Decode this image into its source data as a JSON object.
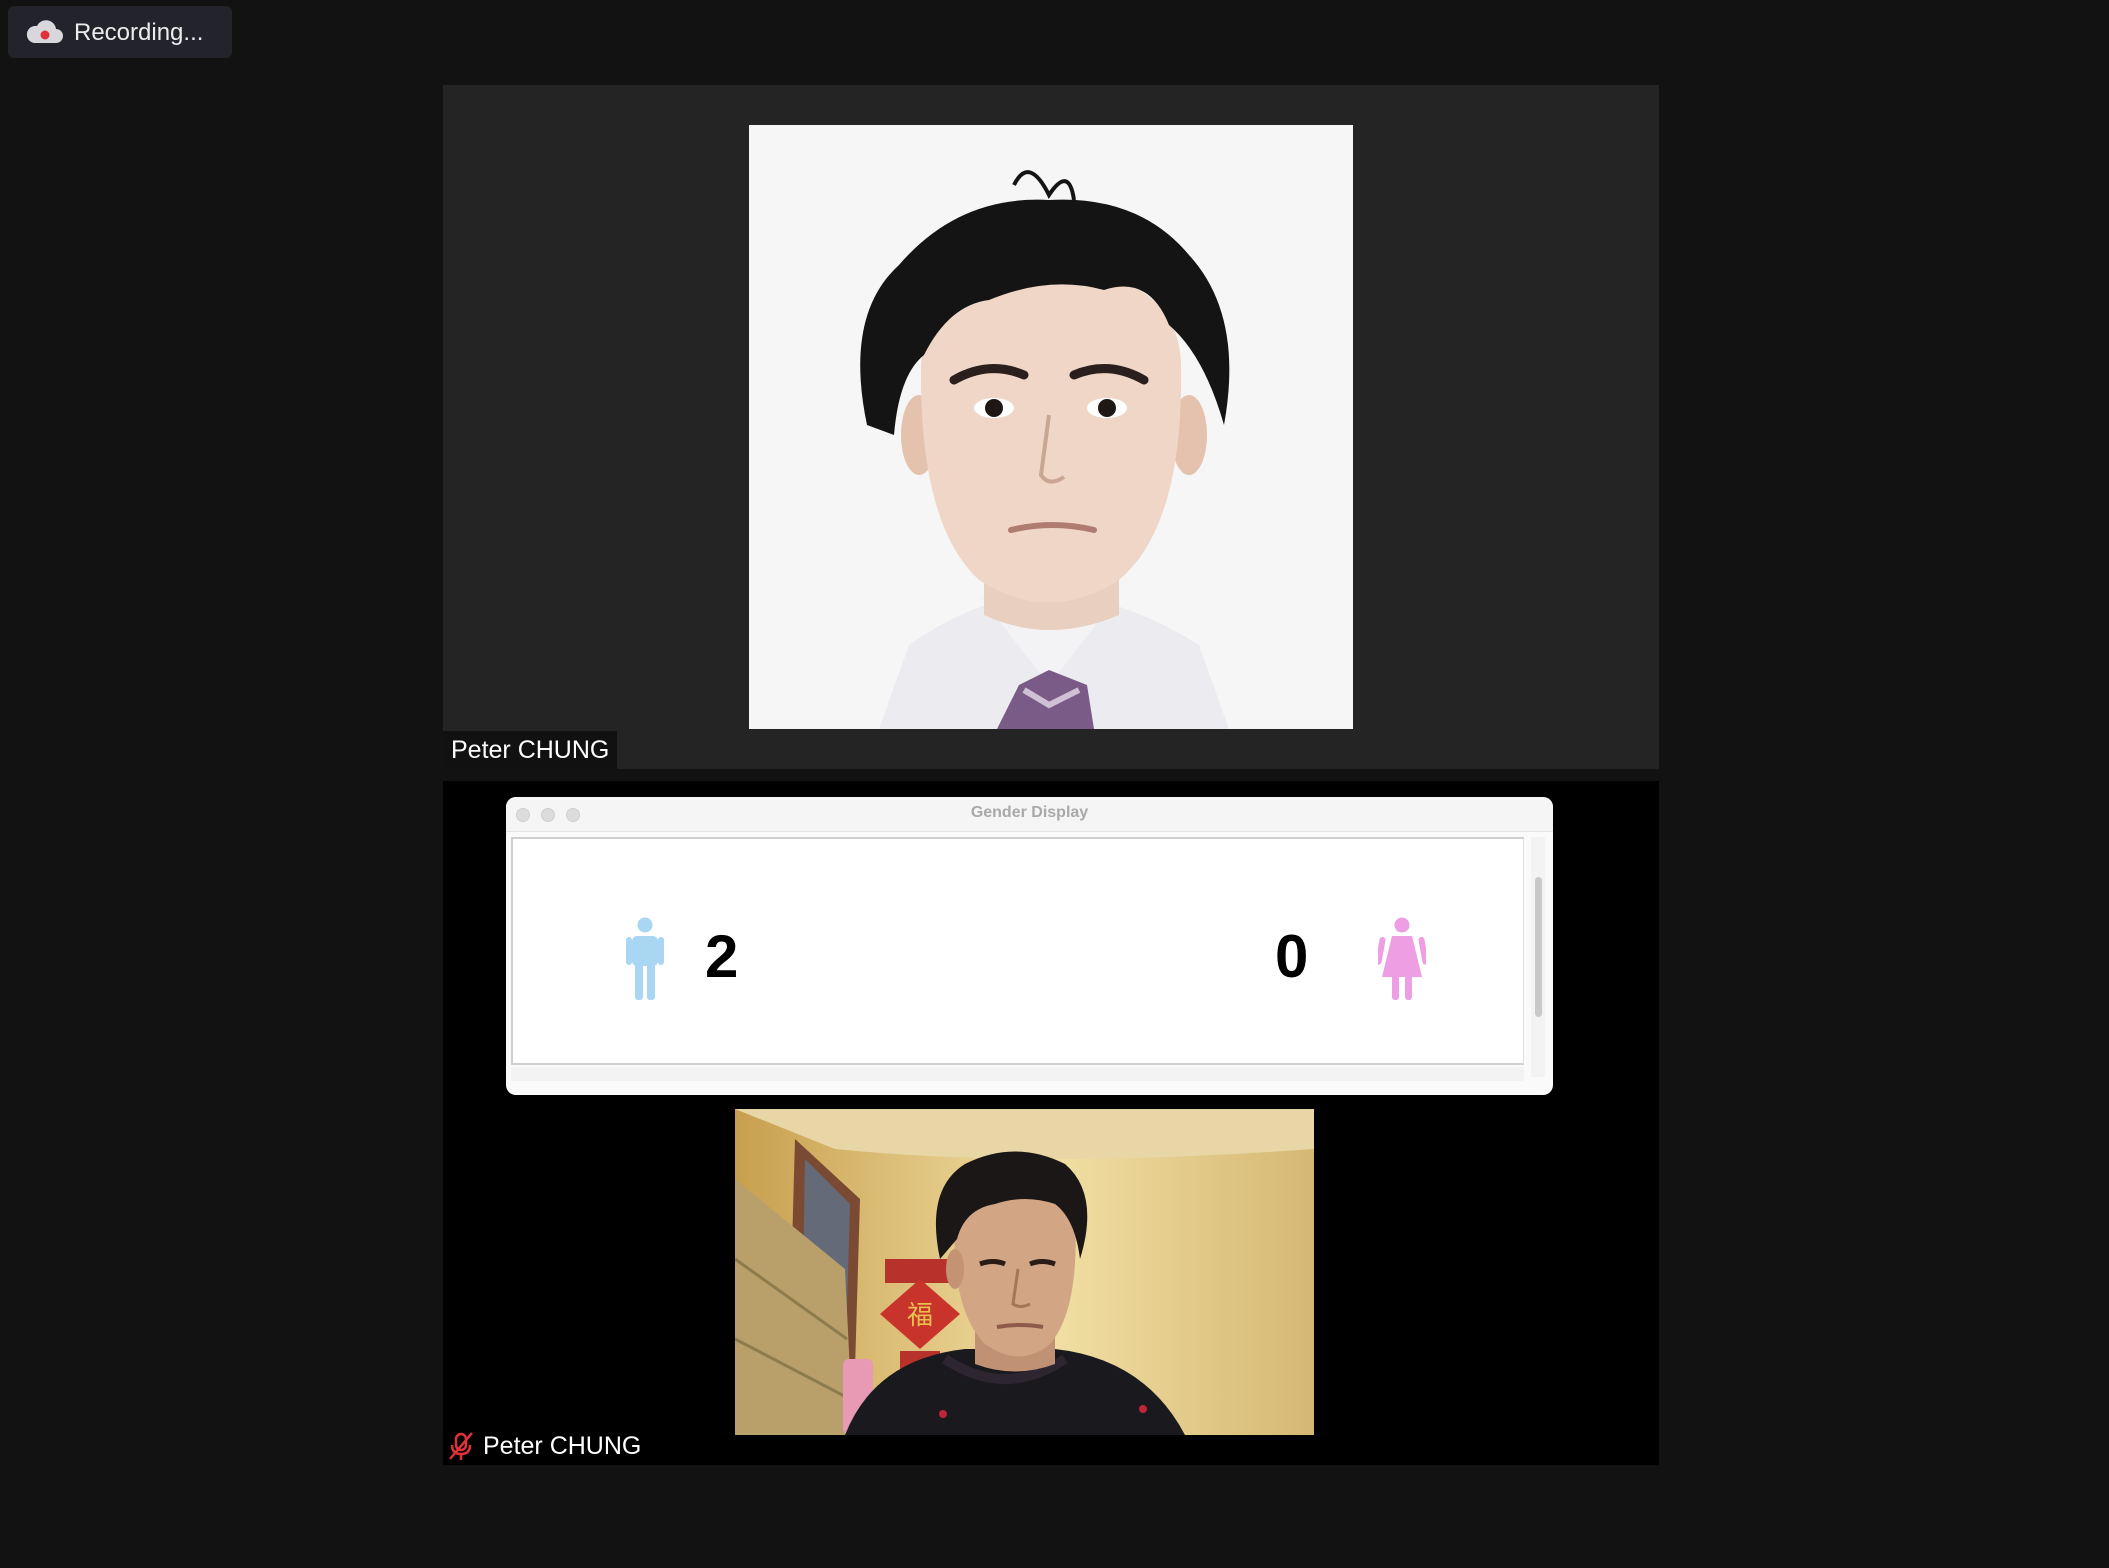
{
  "recording": {
    "label": "Recording...",
    "icon": "cloud-record-icon",
    "indicator_color": "#e0313b"
  },
  "participants": {
    "top": {
      "name": "Peter CHUNG",
      "media": "profile-photo"
    },
    "bottom": {
      "name": "Peter CHUNG",
      "media": "webcam-video",
      "muted": true,
      "mute_icon": "microphone-muted-icon"
    }
  },
  "gender_display": {
    "window_title": "Gender Display",
    "male": {
      "count": "2",
      "icon": "male-person-icon",
      "color": "#a8d6f3"
    },
    "female": {
      "count": "0",
      "icon": "female-person-icon",
      "color": "#ee9fe3"
    }
  }
}
